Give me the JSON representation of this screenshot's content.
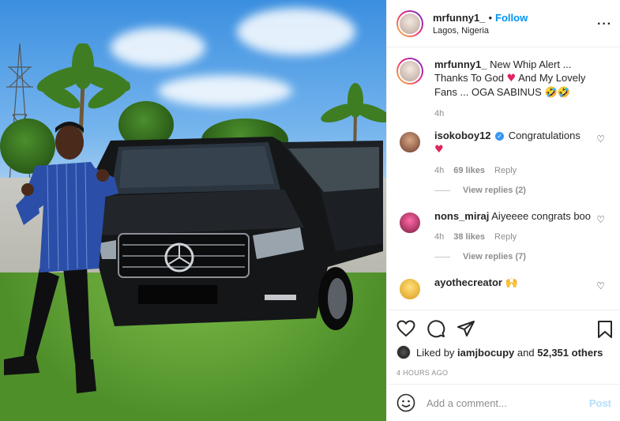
{
  "post": {
    "username": "mrfunny1_",
    "follow_label": "Follow",
    "location": "Lagos, Nigeria",
    "more_icon": "more-horizontal-icon"
  },
  "caption": {
    "username": "mrfunny1_",
    "text_1": "New Whip Alert ... Thanks To God",
    "text_2": "And My Lovely Fans ... OGA SABINUS",
    "emoji": "🤣🤣",
    "time": "4h"
  },
  "comments": [
    {
      "username": "isokoboy12",
      "verified": true,
      "text": "Congratulations",
      "time": "4h",
      "likes": "69 likes",
      "reply_label": "Reply",
      "view_replies": "View replies (2)"
    },
    {
      "username": "nons_miraj",
      "verified": false,
      "text": "Aiyeeee congrats boo",
      "time": "4h",
      "likes": "38 likes",
      "reply_label": "Reply",
      "view_replies": "View replies (7)"
    },
    {
      "username": "ayothecreator",
      "verified": false,
      "text": "🙌"
    }
  ],
  "actions": {
    "liked_by_prefix": "Liked by",
    "liked_by_user": "iamjbocupy",
    "liked_by_and": "and",
    "others": "52,351 others",
    "timestamp": "4 HOURS AGO"
  },
  "composer": {
    "placeholder": "Add a comment...",
    "post_label": "Post"
  }
}
